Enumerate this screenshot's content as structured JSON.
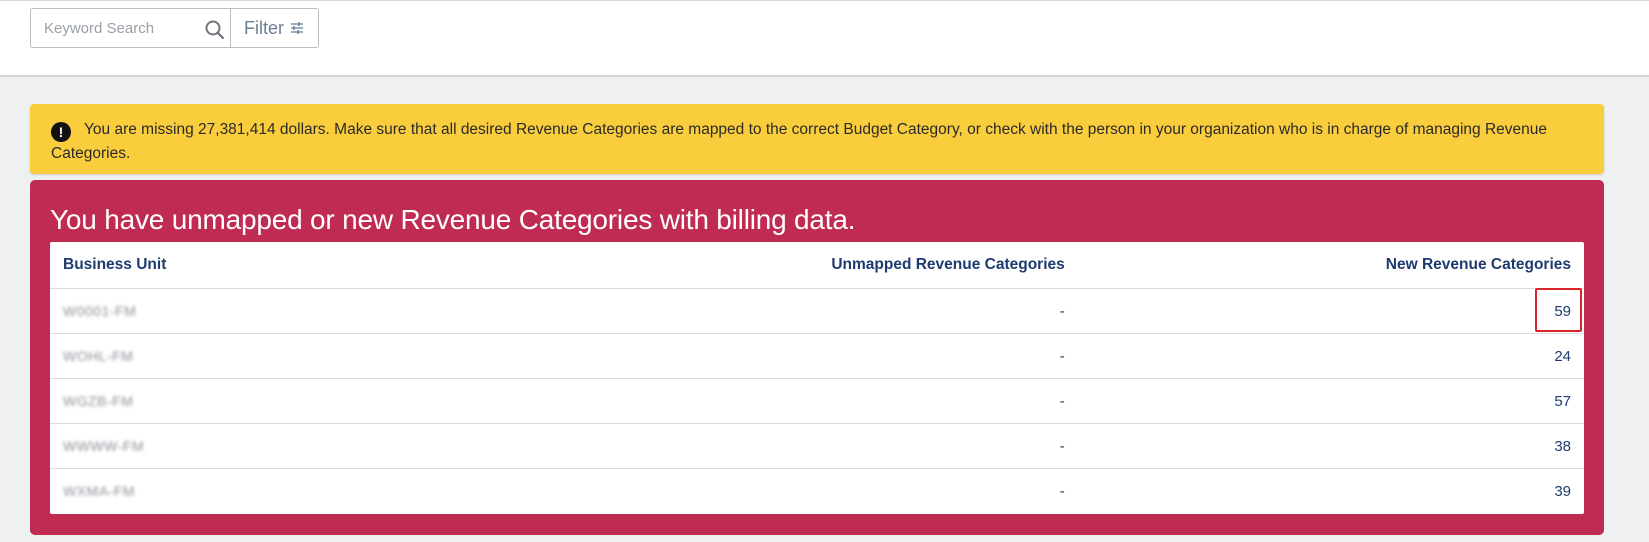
{
  "search": {
    "placeholder": "Keyword Search",
    "value": ""
  },
  "filter": {
    "label": "Filter"
  },
  "warning": {
    "icon": "exclamation-circle-icon",
    "message": "You are missing 27,381,414 dollars. Make sure that all desired Revenue Categories are mapped to the correct Budget Category, or check with the person in your organization who is in charge of managing Revenue Categories."
  },
  "panel": {
    "title": "You have unmapped or new Revenue Categories with billing data."
  },
  "table": {
    "columns": {
      "business_unit": "Business Unit",
      "unmapped": "Unmapped Revenue Categories",
      "new": "New Revenue Categories"
    },
    "rows": [
      {
        "business_unit": "W0001-FM",
        "unmapped": "-",
        "new": "59"
      },
      {
        "business_unit": "WOHL-FM",
        "unmapped": "-",
        "new": "24"
      },
      {
        "business_unit": "WGZB-FM",
        "unmapped": "-",
        "new": "57"
      },
      {
        "business_unit": "WWWW-FM",
        "unmapped": "-",
        "new": "38"
      },
      {
        "business_unit": "WXMA-FM",
        "unmapped": "-",
        "new": "39"
      }
    ]
  },
  "colors": {
    "warning_bg": "#facd3c",
    "panel_bg": "#bf2b52",
    "header_text": "#1e3a6e",
    "highlight": "#d9242b"
  }
}
